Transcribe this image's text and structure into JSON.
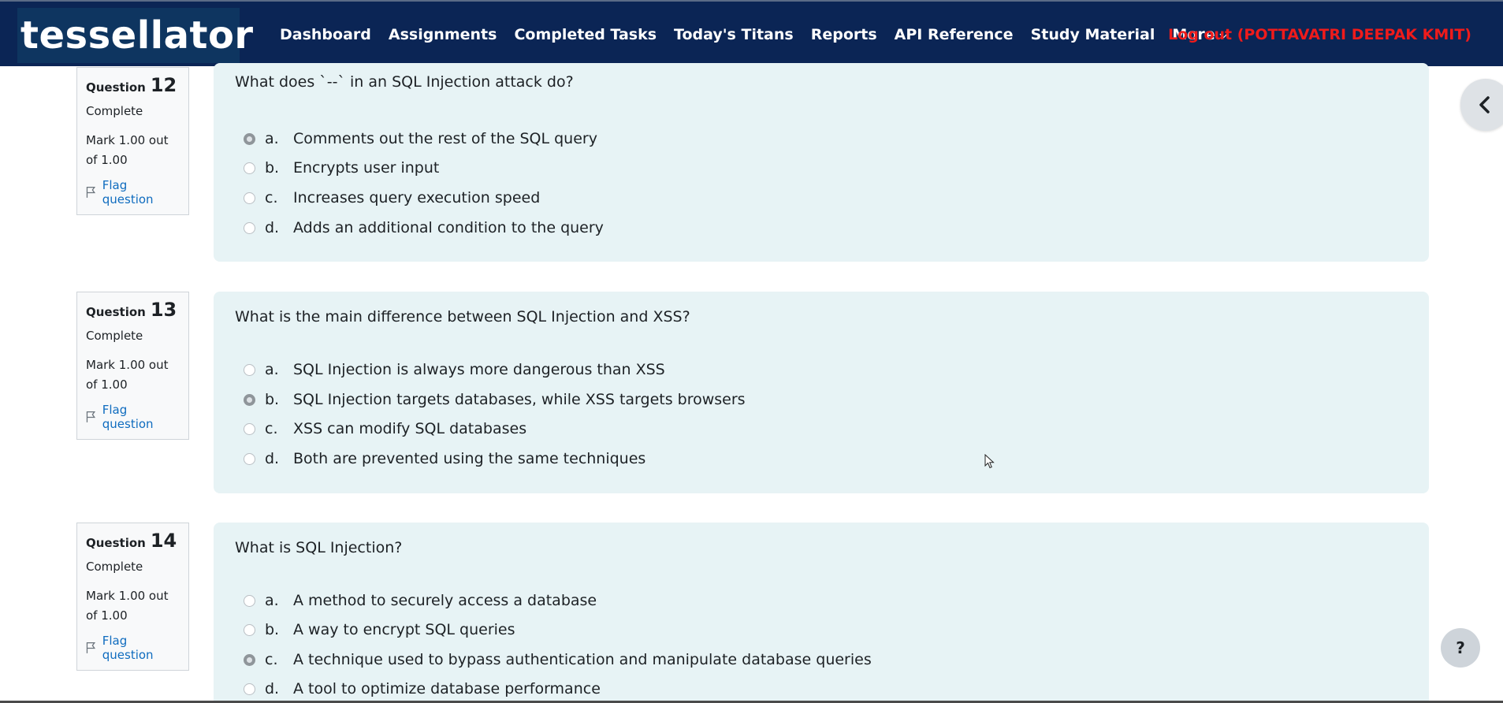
{
  "header": {
    "brand": "tessellator",
    "nav": [
      {
        "label": "Dashboard"
      },
      {
        "label": "Assignments"
      },
      {
        "label": "Completed Tasks"
      },
      {
        "label": "Today's Titans"
      },
      {
        "label": "Reports"
      },
      {
        "label": "API Reference"
      },
      {
        "label": "Study Material"
      },
      {
        "label": "More",
        "icon": "chevron-down-icon"
      }
    ],
    "logout": "Log out (POTTAVATRI DEEPAK KMIT)"
  },
  "drawer_toggle": {
    "icon": "chevron-left-icon"
  },
  "questions": [
    {
      "word": "Question",
      "number": "12",
      "state": "Complete",
      "grade": "Mark 1.00 out of 1.00",
      "flag": "Flag question",
      "text": "What does `--` in an SQL Injection attack do?",
      "answers": [
        {
          "letter": "a.",
          "text": "Comments out the rest of the SQL query",
          "selected": true
        },
        {
          "letter": "b.",
          "text": "Encrypts user input",
          "selected": false
        },
        {
          "letter": "c.",
          "text": "Increases query execution speed",
          "selected": false
        },
        {
          "letter": "d.",
          "text": "Adds an additional condition to the query",
          "selected": false
        }
      ]
    },
    {
      "word": "Question",
      "number": "13",
      "state": "Complete",
      "grade": "Mark 1.00 out of 1.00",
      "flag": "Flag question",
      "text": "What is the main difference between SQL Injection and XSS?",
      "answers": [
        {
          "letter": "a.",
          "text": "SQL Injection is always more dangerous than XSS",
          "selected": false
        },
        {
          "letter": "b.",
          "text": "SQL Injection targets databases, while XSS targets browsers",
          "selected": true
        },
        {
          "letter": "c.",
          "text": "XSS can modify SQL databases",
          "selected": false
        },
        {
          "letter": "d.",
          "text": "Both are prevented using the same techniques",
          "selected": false
        }
      ]
    },
    {
      "word": "Question",
      "number": "14",
      "state": "Complete",
      "grade": "Mark 1.00 out of 1.00",
      "flag": "Flag question",
      "text": "What is SQL Injection?",
      "answers": [
        {
          "letter": "a.",
          "text": "A method to securely access a database",
          "selected": false
        },
        {
          "letter": "b.",
          "text": "A way to encrypt SQL queries",
          "selected": false
        },
        {
          "letter": "c.",
          "text": "A technique used to bypass authentication and manipulate database queries",
          "selected": true
        },
        {
          "letter": "d.",
          "text": "A tool to optimize database performance",
          "selected": false
        }
      ]
    }
  ],
  "help": {
    "label": "?"
  }
}
